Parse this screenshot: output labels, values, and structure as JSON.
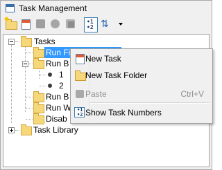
{
  "window": {
    "title": "Task Management"
  },
  "toolbar": {
    "buttons": [
      {
        "name": "new-folder-button",
        "icon": "folder-new-icon"
      },
      {
        "name": "new-task-button",
        "icon": "task-new-icon"
      },
      {
        "name": "toolbar-button-3",
        "icon": "gray-square-icon"
      },
      {
        "name": "toolbar-button-4",
        "icon": "gray-circle-icon"
      },
      {
        "name": "toolbar-button-5",
        "icon": "gray-stack-icon"
      },
      {
        "name": "show-task-numbers-button",
        "icon": "numbers-icon",
        "text": "• 1\n• 2"
      },
      {
        "name": "sort-button",
        "icon": "sort-icon"
      },
      {
        "name": "dropdown-button",
        "icon": "chevron-down-icon"
      }
    ]
  },
  "tree": {
    "root": {
      "label": "Tasks",
      "expanded": true
    },
    "items": [
      {
        "label": "Run First Cycle Tool",
        "visible_label": "Run First Cycle Tool",
        "selected": true
      },
      {
        "label": "Run B",
        "expanded": true
      },
      {
        "label": "1",
        "type": "bullet"
      },
      {
        "label": "2",
        "type": "bullet"
      },
      {
        "label": "Run B"
      },
      {
        "label": "Run W"
      },
      {
        "label": "Disab"
      }
    ],
    "library": {
      "label": "Task Library",
      "expanded": false
    }
  },
  "context_menu": {
    "items": [
      {
        "label": "New Task",
        "icon": "task-icon",
        "enabled": true
      },
      {
        "label": "New Task Folder",
        "icon": "folder-icon",
        "enabled": true
      },
      {
        "label": "Paste",
        "shortcut": "Ctrl+V",
        "icon": "paste-icon",
        "enabled": false
      },
      {
        "label": "Show Task Numbers",
        "icon": "numbers-icon",
        "enabled": true
      }
    ]
  },
  "colors": {
    "selection": "#3399ff",
    "folder": "#f6d77a",
    "menu_background": "#f0f0f0"
  }
}
